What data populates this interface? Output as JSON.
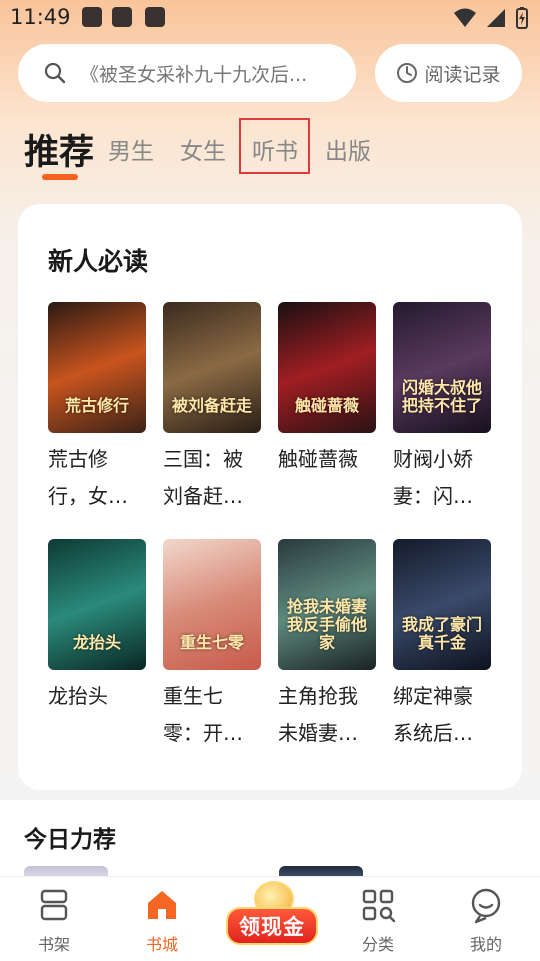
{
  "status_bar": {
    "time": "11:49"
  },
  "search": {
    "placeholder": "《被圣女采补九十九次后..."
  },
  "history_button": {
    "label": "阅读记录"
  },
  "tabs": [
    {
      "label": "推荐",
      "active": true
    },
    {
      "label": "男生"
    },
    {
      "label": "女生"
    },
    {
      "label": "听书",
      "highlighted": true
    },
    {
      "label": "出版"
    }
  ],
  "new_reader_section": {
    "title": "新人必读",
    "books": [
      {
        "name": "荒古修行，女帝竟求我为师",
        "cover_text": "荒古修行",
        "cover_colors": [
          "#2a1a14",
          "#c8541e",
          "#3a2218"
        ]
      },
      {
        "name": "三国：被刘备赶出门外",
        "cover_text": "被刘备赶走",
        "cover_colors": [
          "#3b2a1e",
          "#8a6a44",
          "#2a1e16"
        ]
      },
      {
        "name": "触碰蔷薇",
        "cover_text": "触碰蔷薇",
        "cover_colors": [
          "#1a1012",
          "#a01e22",
          "#2a1214"
        ]
      },
      {
        "name": "财阀小娇妻：闪婚后大叔他把持不住了",
        "cover_text": "闪婚大叔他把持不住了",
        "cover_colors": [
          "#241a2e",
          "#5a3a5e",
          "#16101e"
        ]
      },
      {
        "name": "龙抬头",
        "cover_text": "龙抬头",
        "cover_colors": [
          "#0e3a36",
          "#2a8a7a",
          "#0a2624"
        ]
      },
      {
        "name": "重生七零：开局被悔婚",
        "cover_text": "重生七零",
        "cover_colors": [
          "#f2d8cc",
          "#d88a78",
          "#c85a4a"
        ]
      },
      {
        "name": "主角抢我未婚妻，我反手偷他家",
        "cover_text": "抢我未婚妻我反手偷他家",
        "cover_colors": [
          "#2a3a3e",
          "#5e8a7e",
          "#1a2224"
        ]
      },
      {
        "name": "绑定神豪系统后我成了豪门真千金",
        "cover_text": "我成了豪门真千金",
        "cover_colors": [
          "#141a2a",
          "#3a4a6a",
          "#0e121e"
        ]
      }
    ]
  },
  "today_section": {
    "title": "今日力荐"
  },
  "bottom_nav": [
    {
      "label": "书架",
      "icon": "bookshelf-icon"
    },
    {
      "label": "书城",
      "icon": "store-icon",
      "active": true
    },
    {
      "label": "领现金",
      "icon": "cash-reward-icon"
    },
    {
      "label": "分类",
      "icon": "category-icon"
    },
    {
      "label": "我的",
      "icon": "profile-icon"
    }
  ],
  "colors": {
    "accent": "#f56523",
    "highlight_border": "#e03a3a"
  }
}
